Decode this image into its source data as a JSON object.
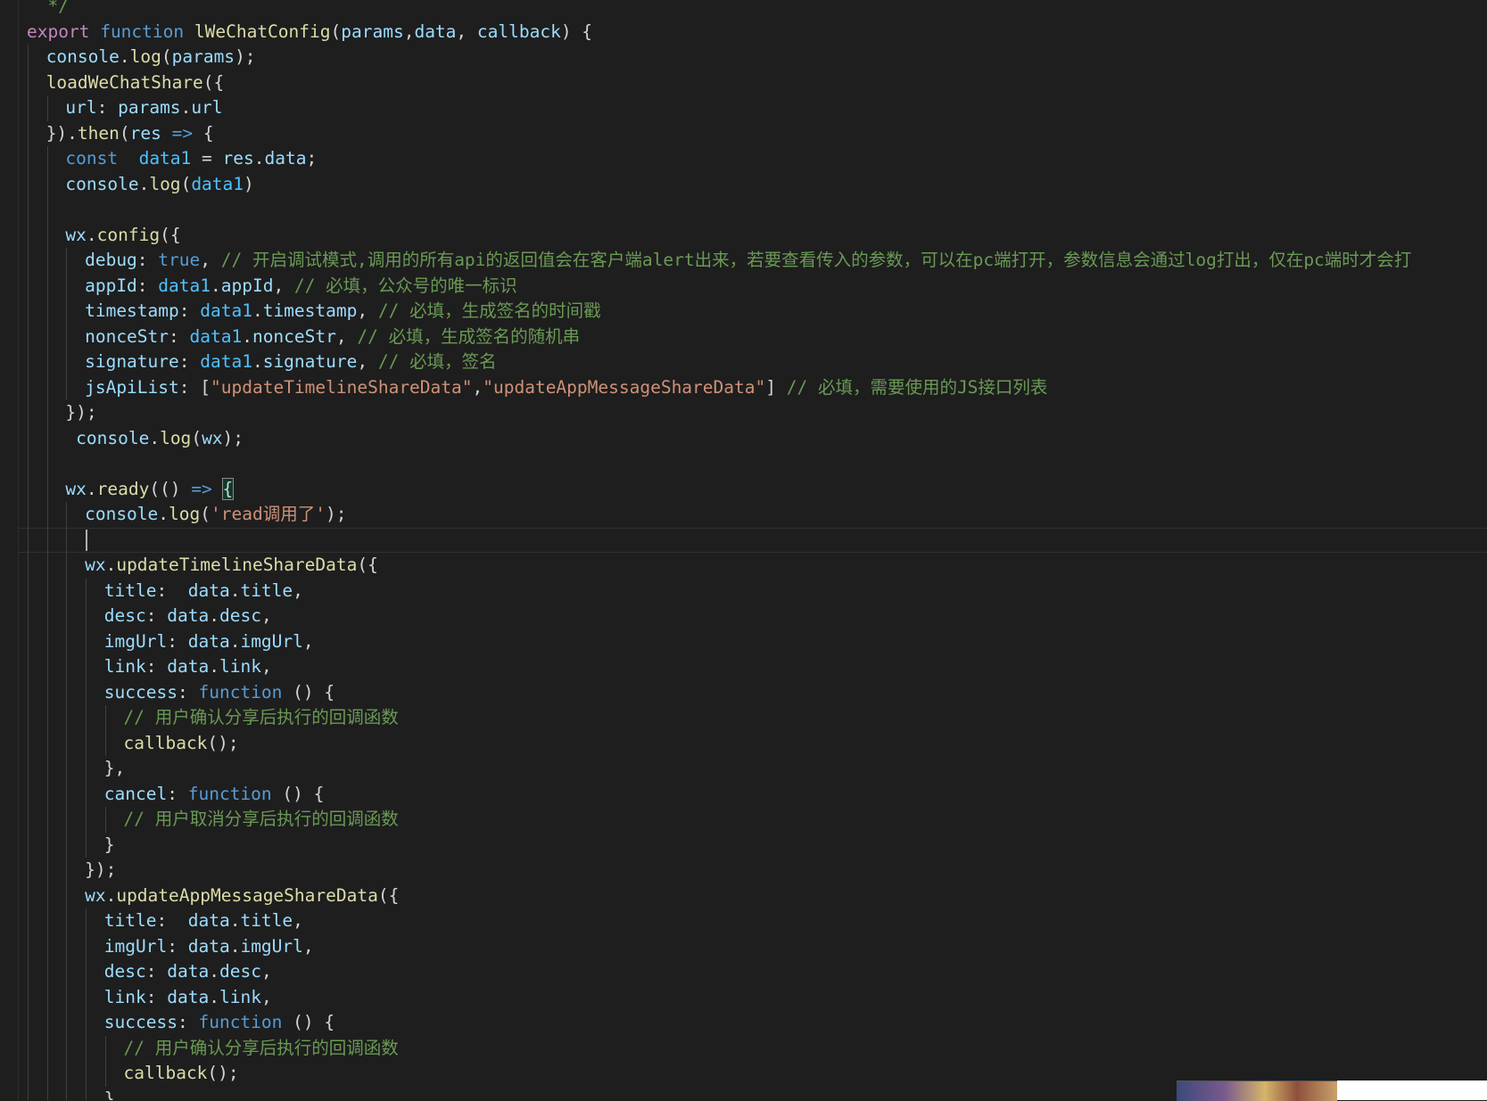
{
  "editor": {
    "theme": "dark",
    "colors": {
      "background": "#1e1e1e",
      "keyword": "#c586c0",
      "storage": "#569cd6",
      "function": "#dcdcaa",
      "variable": "#9cdcfe",
      "constant": "#4fc1ff",
      "string": "#ce9178",
      "comment": "#6a9955",
      "punctuation": "#d4d4d4"
    },
    "cursor_line": 21,
    "lines": [
      {
        "indent": 0,
        "tokens": [
          {
            "t": "  */",
            "c": "cmt"
          }
        ]
      },
      {
        "indent": 0,
        "tokens": [
          {
            "t": "export",
            "c": "kw"
          },
          {
            "t": " ",
            "c": "pun"
          },
          {
            "t": "function",
            "c": "st"
          },
          {
            "t": " ",
            "c": "pun"
          },
          {
            "t": "lWeChatConfig",
            "c": "fn"
          },
          {
            "t": "(",
            "c": "pun"
          },
          {
            "t": "params",
            "c": "var"
          },
          {
            "t": ",",
            "c": "pun"
          },
          {
            "t": "data",
            "c": "var"
          },
          {
            "t": ", ",
            "c": "pun"
          },
          {
            "t": "callback",
            "c": "var"
          },
          {
            "t": ") {",
            "c": "pun"
          }
        ]
      },
      {
        "indent": 1,
        "tokens": [
          {
            "t": "console",
            "c": "var"
          },
          {
            "t": ".",
            "c": "pun"
          },
          {
            "t": "log",
            "c": "fn"
          },
          {
            "t": "(",
            "c": "pun"
          },
          {
            "t": "params",
            "c": "var"
          },
          {
            "t": ");",
            "c": "pun"
          }
        ]
      },
      {
        "indent": 1,
        "tokens": [
          {
            "t": "loadWeChatShare",
            "c": "fn"
          },
          {
            "t": "({",
            "c": "pun"
          }
        ]
      },
      {
        "indent": 2,
        "tokens": [
          {
            "t": "url",
            "c": "var"
          },
          {
            "t": ": ",
            "c": "pun"
          },
          {
            "t": "params",
            "c": "var"
          },
          {
            "t": ".",
            "c": "pun"
          },
          {
            "t": "url",
            "c": "var"
          }
        ]
      },
      {
        "indent": 1,
        "tokens": [
          {
            "t": "}).",
            "c": "pun"
          },
          {
            "t": "then",
            "c": "fn"
          },
          {
            "t": "(",
            "c": "pun"
          },
          {
            "t": "res",
            "c": "var"
          },
          {
            "t": " ",
            "c": "pun"
          },
          {
            "t": "=>",
            "c": "st"
          },
          {
            "t": " {",
            "c": "pun"
          }
        ]
      },
      {
        "indent": 2,
        "tokens": [
          {
            "t": "const",
            "c": "st"
          },
          {
            "t": "  ",
            "c": "pun"
          },
          {
            "t": "data1",
            "c": "const"
          },
          {
            "t": " = ",
            "c": "pun"
          },
          {
            "t": "res",
            "c": "var"
          },
          {
            "t": ".",
            "c": "pun"
          },
          {
            "t": "data",
            "c": "var"
          },
          {
            "t": ";",
            "c": "pun"
          }
        ]
      },
      {
        "indent": 2,
        "tokens": [
          {
            "t": "console",
            "c": "var"
          },
          {
            "t": ".",
            "c": "pun"
          },
          {
            "t": "log",
            "c": "fn"
          },
          {
            "t": "(",
            "c": "pun"
          },
          {
            "t": "data1",
            "c": "const"
          },
          {
            "t": ")",
            "c": "pun"
          }
        ]
      },
      {
        "indent": 2,
        "tokens": []
      },
      {
        "indent": 2,
        "tokens": [
          {
            "t": "wx",
            "c": "var"
          },
          {
            "t": ".",
            "c": "pun"
          },
          {
            "t": "config",
            "c": "fn"
          },
          {
            "t": "({",
            "c": "pun"
          }
        ]
      },
      {
        "indent": 3,
        "tokens": [
          {
            "t": "debug",
            "c": "var"
          },
          {
            "t": ": ",
            "c": "pun"
          },
          {
            "t": "true",
            "c": "st"
          },
          {
            "t": ", ",
            "c": "pun"
          },
          {
            "t": "// 开启调试模式,调用的所有api的返回值会在客户端alert出来，若要查看传入的参数，可以在pc端打开，参数信息会通过log打出，仅在pc端时才会打",
            "c": "cmt"
          }
        ]
      },
      {
        "indent": 3,
        "tokens": [
          {
            "t": "appId",
            "c": "var"
          },
          {
            "t": ": ",
            "c": "pun"
          },
          {
            "t": "data1",
            "c": "const"
          },
          {
            "t": ".",
            "c": "pun"
          },
          {
            "t": "appId",
            "c": "var"
          },
          {
            "t": ", ",
            "c": "pun"
          },
          {
            "t": "// 必填，公众号的唯一标识",
            "c": "cmt"
          }
        ]
      },
      {
        "indent": 3,
        "tokens": [
          {
            "t": "timestamp",
            "c": "var"
          },
          {
            "t": ": ",
            "c": "pun"
          },
          {
            "t": "data1",
            "c": "const"
          },
          {
            "t": ".",
            "c": "pun"
          },
          {
            "t": "timestamp",
            "c": "var"
          },
          {
            "t": ", ",
            "c": "pun"
          },
          {
            "t": "// 必填，生成签名的时间戳",
            "c": "cmt"
          }
        ]
      },
      {
        "indent": 3,
        "tokens": [
          {
            "t": "nonceStr",
            "c": "var"
          },
          {
            "t": ": ",
            "c": "pun"
          },
          {
            "t": "data1",
            "c": "const"
          },
          {
            "t": ".",
            "c": "pun"
          },
          {
            "t": "nonceStr",
            "c": "var"
          },
          {
            "t": ", ",
            "c": "pun"
          },
          {
            "t": "// 必填，生成签名的随机串",
            "c": "cmt"
          }
        ]
      },
      {
        "indent": 3,
        "tokens": [
          {
            "t": "signature",
            "c": "var"
          },
          {
            "t": ": ",
            "c": "pun"
          },
          {
            "t": "data1",
            "c": "const"
          },
          {
            "t": ".",
            "c": "pun"
          },
          {
            "t": "signature",
            "c": "var"
          },
          {
            "t": ", ",
            "c": "pun"
          },
          {
            "t": "// 必填，签名",
            "c": "cmt"
          }
        ]
      },
      {
        "indent": 3,
        "tokens": [
          {
            "t": "jsApiList",
            "c": "var"
          },
          {
            "t": ": [",
            "c": "pun"
          },
          {
            "t": "\"updateTimelineShareData\"",
            "c": "str"
          },
          {
            "t": ",",
            "c": "pun"
          },
          {
            "t": "\"updateAppMessageShareData\"",
            "c": "str"
          },
          {
            "t": "] ",
            "c": "pun"
          },
          {
            "t": "// 必填，需要使用的JS接口列表",
            "c": "cmt"
          }
        ]
      },
      {
        "indent": 2,
        "tokens": [
          {
            "t": "});",
            "c": "pun"
          }
        ]
      },
      {
        "indent": 2,
        "tokens": [
          {
            "t": " ",
            "c": "pun"
          },
          {
            "t": "console",
            "c": "var"
          },
          {
            "t": ".",
            "c": "pun"
          },
          {
            "t": "log",
            "c": "fn"
          },
          {
            "t": "(",
            "c": "pun"
          },
          {
            "t": "wx",
            "c": "var"
          },
          {
            "t": ");",
            "c": "pun"
          }
        ]
      },
      {
        "indent": 2,
        "tokens": []
      },
      {
        "indent": 2,
        "tokens": [
          {
            "t": "wx",
            "c": "var"
          },
          {
            "t": ".",
            "c": "pun"
          },
          {
            "t": "ready",
            "c": "fn"
          },
          {
            "t": "(() ",
            "c": "pun"
          },
          {
            "t": "=>",
            "c": "st"
          },
          {
            "t": " ",
            "c": "pun"
          },
          {
            "t": "{",
            "c": "pun",
            "hl": true
          }
        ]
      },
      {
        "indent": 3,
        "tokens": [
          {
            "t": "console",
            "c": "var"
          },
          {
            "t": ".",
            "c": "pun"
          },
          {
            "t": "log",
            "c": "fn"
          },
          {
            "t": "(",
            "c": "pun"
          },
          {
            "t": "'read调用了'",
            "c": "str"
          },
          {
            "t": ");",
            "c": "pun"
          }
        ]
      },
      {
        "indent": 3,
        "tokens": []
      },
      {
        "indent": 3,
        "tokens": [
          {
            "t": "wx",
            "c": "var"
          },
          {
            "t": ".",
            "c": "pun"
          },
          {
            "t": "updateTimelineShareData",
            "c": "fn"
          },
          {
            "t": "({",
            "c": "pun"
          }
        ]
      },
      {
        "indent": 4,
        "tokens": [
          {
            "t": "title",
            "c": "var"
          },
          {
            "t": ":  ",
            "c": "pun"
          },
          {
            "t": "data",
            "c": "var"
          },
          {
            "t": ".",
            "c": "pun"
          },
          {
            "t": "title",
            "c": "var"
          },
          {
            "t": ",",
            "c": "pun"
          }
        ]
      },
      {
        "indent": 4,
        "tokens": [
          {
            "t": "desc",
            "c": "var"
          },
          {
            "t": ": ",
            "c": "pun"
          },
          {
            "t": "data",
            "c": "var"
          },
          {
            "t": ".",
            "c": "pun"
          },
          {
            "t": "desc",
            "c": "var"
          },
          {
            "t": ",",
            "c": "pun"
          }
        ]
      },
      {
        "indent": 4,
        "tokens": [
          {
            "t": "imgUrl",
            "c": "var"
          },
          {
            "t": ": ",
            "c": "pun"
          },
          {
            "t": "data",
            "c": "var"
          },
          {
            "t": ".",
            "c": "pun"
          },
          {
            "t": "imgUrl",
            "c": "var"
          },
          {
            "t": ",",
            "c": "pun"
          }
        ]
      },
      {
        "indent": 4,
        "tokens": [
          {
            "t": "link",
            "c": "var"
          },
          {
            "t": ": ",
            "c": "pun"
          },
          {
            "t": "data",
            "c": "var"
          },
          {
            "t": ".",
            "c": "pun"
          },
          {
            "t": "link",
            "c": "var"
          },
          {
            "t": ",",
            "c": "pun"
          }
        ]
      },
      {
        "indent": 4,
        "tokens": [
          {
            "t": "success",
            "c": "var"
          },
          {
            "t": ": ",
            "c": "pun"
          },
          {
            "t": "function",
            "c": "st"
          },
          {
            "t": " () {",
            "c": "pun"
          }
        ]
      },
      {
        "indent": 5,
        "tokens": [
          {
            "t": "// 用户确认分享后执行的回调函数",
            "c": "cmt"
          }
        ]
      },
      {
        "indent": 5,
        "tokens": [
          {
            "t": "callback",
            "c": "fn"
          },
          {
            "t": "();",
            "c": "pun"
          }
        ]
      },
      {
        "indent": 4,
        "tokens": [
          {
            "t": "},",
            "c": "pun"
          }
        ]
      },
      {
        "indent": 4,
        "tokens": [
          {
            "t": "cancel",
            "c": "var"
          },
          {
            "t": ": ",
            "c": "pun"
          },
          {
            "t": "function",
            "c": "st"
          },
          {
            "t": " () {",
            "c": "pun"
          }
        ]
      },
      {
        "indent": 5,
        "tokens": [
          {
            "t": "// 用户取消分享后执行的回调函数",
            "c": "cmt"
          }
        ]
      },
      {
        "indent": 4,
        "tokens": [
          {
            "t": "}",
            "c": "pun"
          }
        ]
      },
      {
        "indent": 3,
        "tokens": [
          {
            "t": "});",
            "c": "pun"
          }
        ]
      },
      {
        "indent": 3,
        "tokens": [
          {
            "t": "wx",
            "c": "var"
          },
          {
            "t": ".",
            "c": "pun"
          },
          {
            "t": "updateAppMessageShareData",
            "c": "fn"
          },
          {
            "t": "({",
            "c": "pun"
          }
        ]
      },
      {
        "indent": 4,
        "tokens": [
          {
            "t": "title",
            "c": "var"
          },
          {
            "t": ":  ",
            "c": "pun"
          },
          {
            "t": "data",
            "c": "var"
          },
          {
            "t": ".",
            "c": "pun"
          },
          {
            "t": "title",
            "c": "var"
          },
          {
            "t": ",",
            "c": "pun"
          }
        ]
      },
      {
        "indent": 4,
        "tokens": [
          {
            "t": "imgUrl",
            "c": "var"
          },
          {
            "t": ": ",
            "c": "pun"
          },
          {
            "t": "data",
            "c": "var"
          },
          {
            "t": ".",
            "c": "pun"
          },
          {
            "t": "imgUrl",
            "c": "var"
          },
          {
            "t": ",",
            "c": "pun"
          }
        ]
      },
      {
        "indent": 4,
        "tokens": [
          {
            "t": "desc",
            "c": "var"
          },
          {
            "t": ": ",
            "c": "pun"
          },
          {
            "t": "data",
            "c": "var"
          },
          {
            "t": ".",
            "c": "pun"
          },
          {
            "t": "desc",
            "c": "var"
          },
          {
            "t": ",",
            "c": "pun"
          }
        ]
      },
      {
        "indent": 4,
        "tokens": [
          {
            "t": "link",
            "c": "var"
          },
          {
            "t": ": ",
            "c": "pun"
          },
          {
            "t": "data",
            "c": "var"
          },
          {
            "t": ".",
            "c": "pun"
          },
          {
            "t": "link",
            "c": "var"
          },
          {
            "t": ",",
            "c": "pun"
          }
        ]
      },
      {
        "indent": 4,
        "tokens": [
          {
            "t": "success",
            "c": "var"
          },
          {
            "t": ": ",
            "c": "pun"
          },
          {
            "t": "function",
            "c": "st"
          },
          {
            "t": " () {",
            "c": "pun"
          }
        ]
      },
      {
        "indent": 5,
        "tokens": [
          {
            "t": "// 用户确认分享后执行的回调函数",
            "c": "cmt"
          }
        ]
      },
      {
        "indent": 5,
        "tokens": [
          {
            "t": "callback",
            "c": "fn"
          },
          {
            "t": "();",
            "c": "pun"
          }
        ]
      },
      {
        "indent": 4,
        "tokens": [
          {
            "t": "}",
            "c": "pun"
          }
        ]
      }
    ]
  },
  "overlay": {
    "thumbnail_icon": "game-thumbnail"
  }
}
